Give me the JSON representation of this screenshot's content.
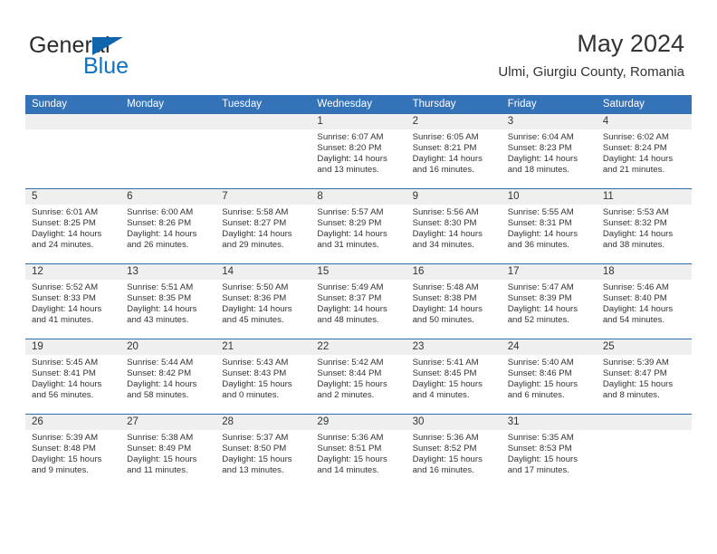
{
  "brand": {
    "name_top": "General",
    "name_bottom": "Blue",
    "accent_color": "#1272bd"
  },
  "header": {
    "title": "May 2024",
    "subtitle": "Ulmi, Giurgiu County, Romania"
  },
  "theme": {
    "header_row_bg": "#3573b9",
    "header_row_text": "#ffffff",
    "row_divider": "#2e6da8",
    "daynum_band_bg": "#efefef",
    "body_text": "#333333"
  },
  "weekday_headers": [
    "Sunday",
    "Monday",
    "Tuesday",
    "Wednesday",
    "Thursday",
    "Friday",
    "Saturday"
  ],
  "weeks": [
    [
      {
        "day": "",
        "lines": []
      },
      {
        "day": "",
        "lines": []
      },
      {
        "day": "",
        "lines": []
      },
      {
        "day": "1",
        "lines": [
          "Sunrise: 6:07 AM",
          "Sunset: 8:20 PM",
          "Daylight: 14 hours",
          "and 13 minutes."
        ]
      },
      {
        "day": "2",
        "lines": [
          "Sunrise: 6:05 AM",
          "Sunset: 8:21 PM",
          "Daylight: 14 hours",
          "and 16 minutes."
        ]
      },
      {
        "day": "3",
        "lines": [
          "Sunrise: 6:04 AM",
          "Sunset: 8:23 PM",
          "Daylight: 14 hours",
          "and 18 minutes."
        ]
      },
      {
        "day": "4",
        "lines": [
          "Sunrise: 6:02 AM",
          "Sunset: 8:24 PM",
          "Daylight: 14 hours",
          "and 21 minutes."
        ]
      }
    ],
    [
      {
        "day": "5",
        "lines": [
          "Sunrise: 6:01 AM",
          "Sunset: 8:25 PM",
          "Daylight: 14 hours",
          "and 24 minutes."
        ]
      },
      {
        "day": "6",
        "lines": [
          "Sunrise: 6:00 AM",
          "Sunset: 8:26 PM",
          "Daylight: 14 hours",
          "and 26 minutes."
        ]
      },
      {
        "day": "7",
        "lines": [
          "Sunrise: 5:58 AM",
          "Sunset: 8:27 PM",
          "Daylight: 14 hours",
          "and 29 minutes."
        ]
      },
      {
        "day": "8",
        "lines": [
          "Sunrise: 5:57 AM",
          "Sunset: 8:29 PM",
          "Daylight: 14 hours",
          "and 31 minutes."
        ]
      },
      {
        "day": "9",
        "lines": [
          "Sunrise: 5:56 AM",
          "Sunset: 8:30 PM",
          "Daylight: 14 hours",
          "and 34 minutes."
        ]
      },
      {
        "day": "10",
        "lines": [
          "Sunrise: 5:55 AM",
          "Sunset: 8:31 PM",
          "Daylight: 14 hours",
          "and 36 minutes."
        ]
      },
      {
        "day": "11",
        "lines": [
          "Sunrise: 5:53 AM",
          "Sunset: 8:32 PM",
          "Daylight: 14 hours",
          "and 38 minutes."
        ]
      }
    ],
    [
      {
        "day": "12",
        "lines": [
          "Sunrise: 5:52 AM",
          "Sunset: 8:33 PM",
          "Daylight: 14 hours",
          "and 41 minutes."
        ]
      },
      {
        "day": "13",
        "lines": [
          "Sunrise: 5:51 AM",
          "Sunset: 8:35 PM",
          "Daylight: 14 hours",
          "and 43 minutes."
        ]
      },
      {
        "day": "14",
        "lines": [
          "Sunrise: 5:50 AM",
          "Sunset: 8:36 PM",
          "Daylight: 14 hours",
          "and 45 minutes."
        ]
      },
      {
        "day": "15",
        "lines": [
          "Sunrise: 5:49 AM",
          "Sunset: 8:37 PM",
          "Daylight: 14 hours",
          "and 48 minutes."
        ]
      },
      {
        "day": "16",
        "lines": [
          "Sunrise: 5:48 AM",
          "Sunset: 8:38 PM",
          "Daylight: 14 hours",
          "and 50 minutes."
        ]
      },
      {
        "day": "17",
        "lines": [
          "Sunrise: 5:47 AM",
          "Sunset: 8:39 PM",
          "Daylight: 14 hours",
          "and 52 minutes."
        ]
      },
      {
        "day": "18",
        "lines": [
          "Sunrise: 5:46 AM",
          "Sunset: 8:40 PM",
          "Daylight: 14 hours",
          "and 54 minutes."
        ]
      }
    ],
    [
      {
        "day": "19",
        "lines": [
          "Sunrise: 5:45 AM",
          "Sunset: 8:41 PM",
          "Daylight: 14 hours",
          "and 56 minutes."
        ]
      },
      {
        "day": "20",
        "lines": [
          "Sunrise: 5:44 AM",
          "Sunset: 8:42 PM",
          "Daylight: 14 hours",
          "and 58 minutes."
        ]
      },
      {
        "day": "21",
        "lines": [
          "Sunrise: 5:43 AM",
          "Sunset: 8:43 PM",
          "Daylight: 15 hours",
          "and 0 minutes."
        ]
      },
      {
        "day": "22",
        "lines": [
          "Sunrise: 5:42 AM",
          "Sunset: 8:44 PM",
          "Daylight: 15 hours",
          "and 2 minutes."
        ]
      },
      {
        "day": "23",
        "lines": [
          "Sunrise: 5:41 AM",
          "Sunset: 8:45 PM",
          "Daylight: 15 hours",
          "and 4 minutes."
        ]
      },
      {
        "day": "24",
        "lines": [
          "Sunrise: 5:40 AM",
          "Sunset: 8:46 PM",
          "Daylight: 15 hours",
          "and 6 minutes."
        ]
      },
      {
        "day": "25",
        "lines": [
          "Sunrise: 5:39 AM",
          "Sunset: 8:47 PM",
          "Daylight: 15 hours",
          "and 8 minutes."
        ]
      }
    ],
    [
      {
        "day": "26",
        "lines": [
          "Sunrise: 5:39 AM",
          "Sunset: 8:48 PM",
          "Daylight: 15 hours",
          "and 9 minutes."
        ]
      },
      {
        "day": "27",
        "lines": [
          "Sunrise: 5:38 AM",
          "Sunset: 8:49 PM",
          "Daylight: 15 hours",
          "and 11 minutes."
        ]
      },
      {
        "day": "28",
        "lines": [
          "Sunrise: 5:37 AM",
          "Sunset: 8:50 PM",
          "Daylight: 15 hours",
          "and 13 minutes."
        ]
      },
      {
        "day": "29",
        "lines": [
          "Sunrise: 5:36 AM",
          "Sunset: 8:51 PM",
          "Daylight: 15 hours",
          "and 14 minutes."
        ]
      },
      {
        "day": "30",
        "lines": [
          "Sunrise: 5:36 AM",
          "Sunset: 8:52 PM",
          "Daylight: 15 hours",
          "and 16 minutes."
        ]
      },
      {
        "day": "31",
        "lines": [
          "Sunrise: 5:35 AM",
          "Sunset: 8:53 PM",
          "Daylight: 15 hours",
          "and 17 minutes."
        ]
      },
      {
        "day": "",
        "lines": []
      }
    ]
  ]
}
